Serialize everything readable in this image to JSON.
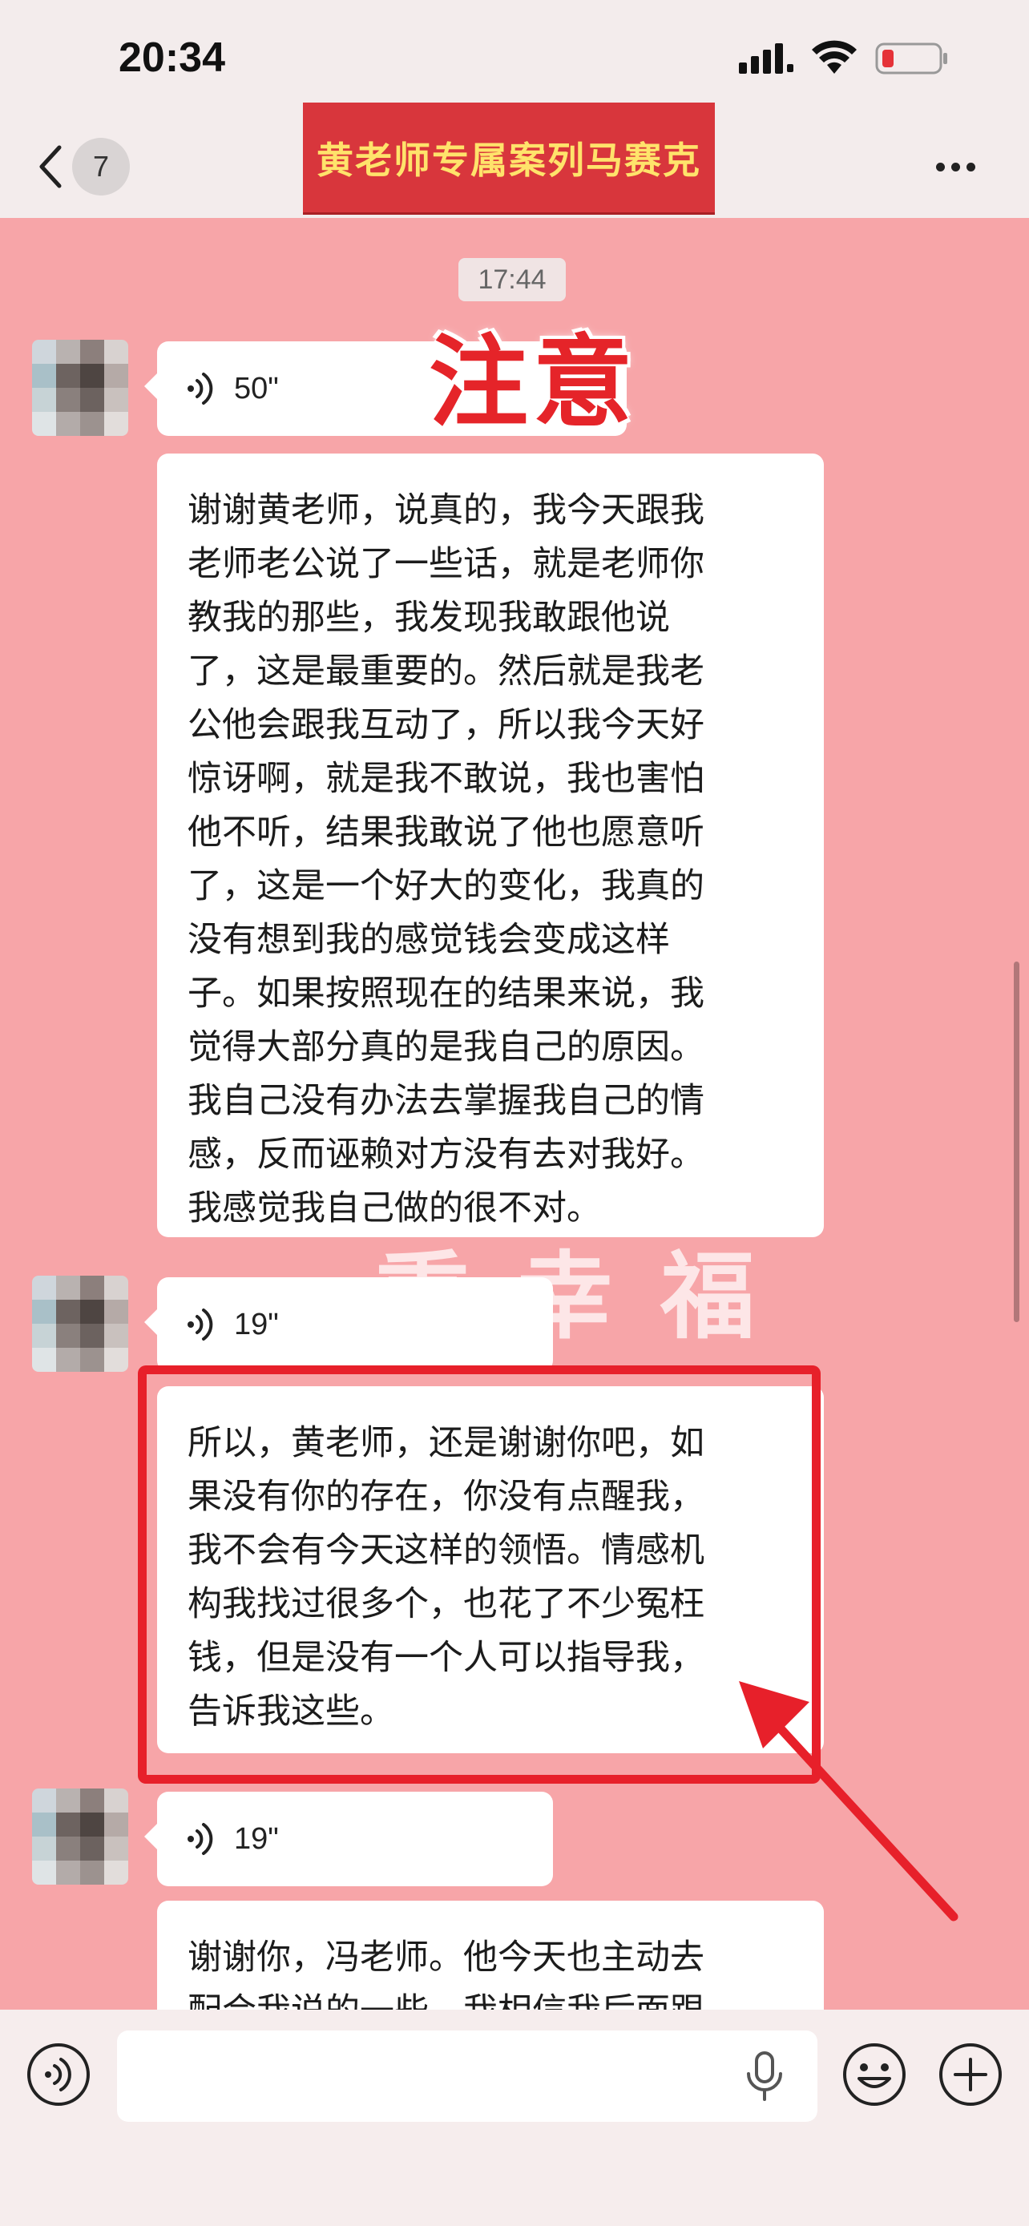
{
  "status_bar": {
    "time": "20:34"
  },
  "nav": {
    "back_count": "7",
    "title": "黄老师专属案列马赛克"
  },
  "chat": {
    "timestamp": "17:44",
    "overlay_warning": "注意",
    "watermark": "重幸福",
    "messages": [
      {
        "type": "voice",
        "duration": "50\""
      },
      {
        "type": "text",
        "lines": [
          "谢谢黄老师，说真的，我今天跟我",
          "老师老公说了一些话，就是老师你",
          "教我的那些，我发现我敢跟他说",
          "了，这是最重要的。然后就是我老",
          "公他会跟我互动了，所以我今天好",
          "惊讶啊，就是我不敢说，我也害怕",
          "他不听，结果我敢说了他也愿意听",
          "了，这是一个好大的变化，我真的",
          "没有想到我的感觉钱会变成这样",
          "子。如果按照现在的结果来说，我",
          "觉得大部分真的是我自己的原因。",
          "我自己没有办法去掌握我自己的情",
          "感，反而诬赖对方没有去对我好。",
          "我感觉我自己做的很不对。"
        ]
      },
      {
        "type": "voice",
        "duration": "19\""
      },
      {
        "type": "text",
        "lines": [
          "所以，黄老师，还是谢谢你吧，如",
          "果没有你的存在，你没有点醒我，",
          "我不会有今天这样的领悟。情感机",
          "构我找过很多个，也花了不少冤枉",
          "钱，但是没有一个人可以指导我，",
          "告诉我这些。"
        ]
      },
      {
        "type": "voice",
        "duration": "19\""
      },
      {
        "type": "text",
        "lines": [
          "谢谢你，冯老师。他今天也主动去",
          "配合我说的一些，我相信我后面跟"
        ]
      }
    ]
  },
  "input": {
    "placeholder": ""
  },
  "colors": {
    "background": "#f7a5a8",
    "highlight": "#e7202a",
    "banner": "#d8363c",
    "banner_text": "#ffe36b"
  },
  "icons": [
    "chevron-left-icon",
    "signal-icon",
    "wifi-icon",
    "battery-icon",
    "more-icon",
    "voice-wave-icon",
    "microphone-icon",
    "emoji-icon",
    "plus-icon",
    "arrow-icon"
  ]
}
